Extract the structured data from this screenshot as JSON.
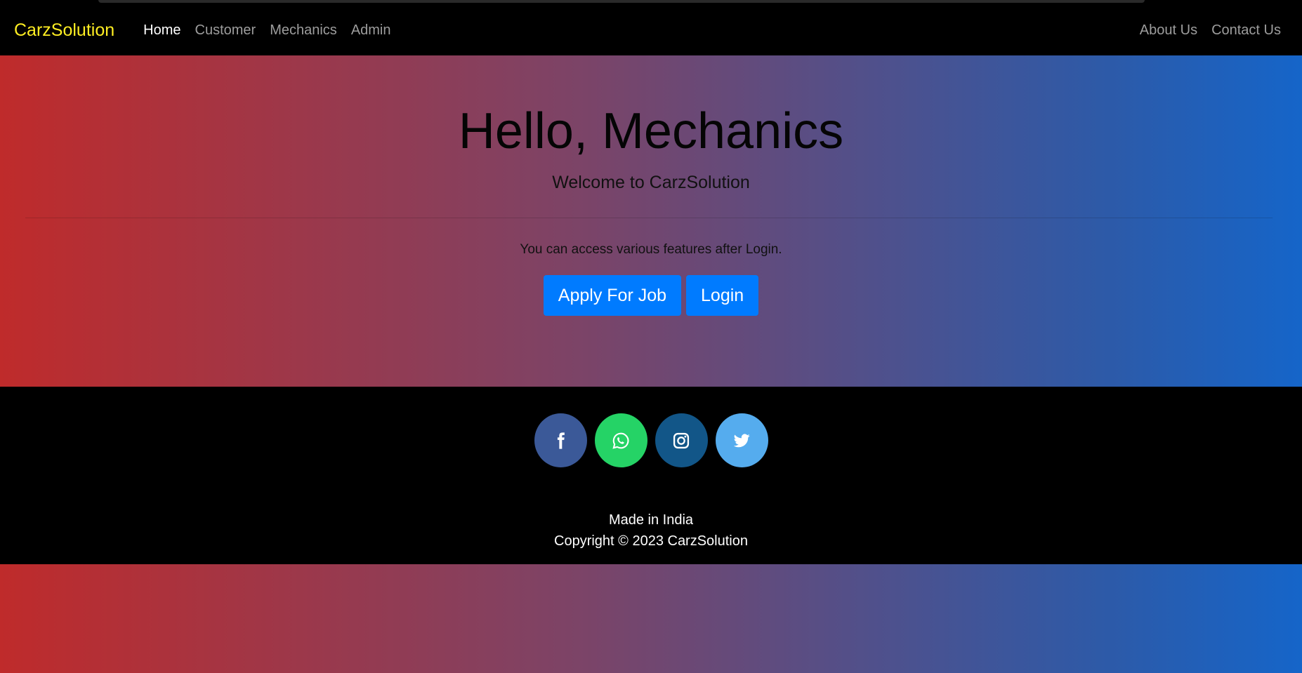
{
  "navbar": {
    "brand": "CarzSolution",
    "left_links": [
      {
        "label": "Home",
        "active": true
      },
      {
        "label": "Customer",
        "active": false
      },
      {
        "label": "Mechanics",
        "active": false
      },
      {
        "label": "Admin",
        "active": false
      }
    ],
    "right_links": [
      {
        "label": "About Us"
      },
      {
        "label": "Contact Us"
      }
    ],
    "brand_color": "#ffee22"
  },
  "hero": {
    "title": "Hello, Mechanics",
    "lead": "Welcome to CarzSolution",
    "info": "You can access various features after Login.",
    "buttons": {
      "apply": "Apply For Job",
      "login": "Login"
    },
    "button_color": "#007bff",
    "gradient": [
      "#bf2b2b",
      "#7b4468",
      "#2d5aa8",
      "#1565c9"
    ]
  },
  "footer": {
    "socials": [
      {
        "icon": "facebook-icon",
        "color": "#3b5998"
      },
      {
        "icon": "whatsapp-icon",
        "color": "#25d366"
      },
      {
        "icon": "instagram-icon",
        "color": "#125688"
      },
      {
        "icon": "twitter-icon",
        "color": "#55acee"
      }
    ],
    "made_in": "Made in India",
    "copyright": "Copyright © 2023 CarzSolution"
  }
}
